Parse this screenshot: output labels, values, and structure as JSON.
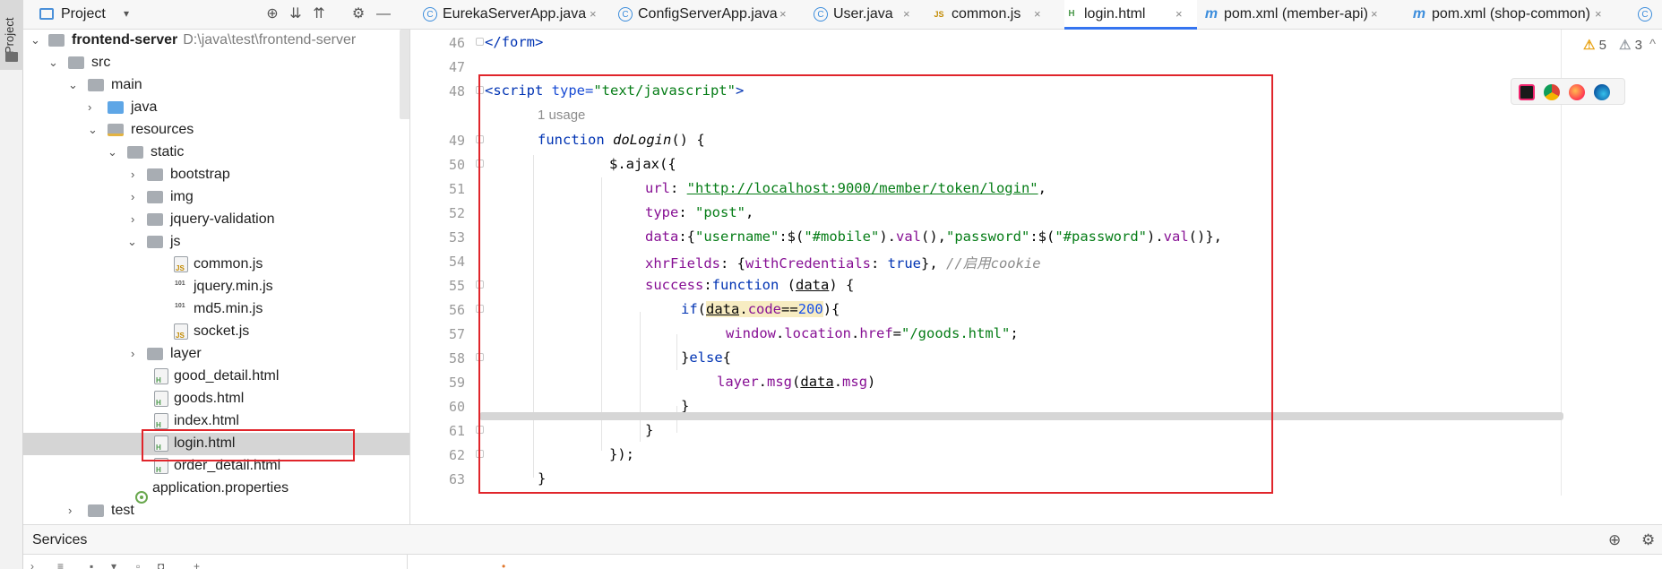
{
  "tool_stripe": {
    "label": "Project"
  },
  "project_header": {
    "title": "Project",
    "caret": "▾",
    "btn_locate": "⊕",
    "btn_expand": "⇊",
    "btn_collapse": "⇈",
    "btn_settings": "⚙",
    "btn_hide": "—"
  },
  "tabs": [
    {
      "label": "EurekaServerApp.java",
      "icon": "C"
    },
    {
      "label": "ConfigServerApp.java",
      "icon": "C"
    },
    {
      "label": "User.java",
      "icon": "C"
    },
    {
      "label": "common.js",
      "icon": "JS"
    },
    {
      "label": "login.html",
      "icon": "H"
    },
    {
      "label": "pom.xml (member-api)",
      "icon": "m"
    },
    {
      "label": "pom.xml (shop-common)",
      "icon": "m"
    },
    {
      "label": "",
      "icon": "C"
    }
  ],
  "tab_close": "×",
  "tree": {
    "root": {
      "name": "frontend-server",
      "path": "D:\\java\\test\\frontend-server"
    },
    "src": "src",
    "main": "main",
    "java": "java",
    "resources": "resources",
    "static": "static",
    "bootstrap": "bootstrap",
    "img": "img",
    "jquery_validation": "jquery-validation",
    "js": "js",
    "common_js": "common.js",
    "jquery_min_js": "jquery.min.js",
    "md5_min_js": "md5.min.js",
    "socket_js": "socket.js",
    "layer": "layer",
    "good_detail": "good_detail.html",
    "goods": "goods.html",
    "index": "index.html",
    "login": "login.html",
    "order_detail": "order_detail.html",
    "app_props": "application.properties",
    "test": "test",
    "file_badge_js": "JS",
    "file_badge_html": "H",
    "file_badge_bin": "101"
  },
  "editor": {
    "line_numbers": [
      "46",
      "47",
      "48",
      "49",
      "50",
      "51",
      "52",
      "53",
      "54",
      "55",
      "56",
      "57",
      "58",
      "59",
      "60",
      "61",
      "62",
      "63"
    ],
    "usage_hint": "1 usage",
    "warnings": {
      "count_a": "5",
      "count_b": "3",
      "tri": "⚠",
      "caret": "^"
    },
    "code": {
      "l46_tag": "</form>",
      "l48_open": "<script ",
      "l48_attr": "type=",
      "l48_val": "\"text/javascript\"",
      "l48_close": ">",
      "l49_kw": "function ",
      "l49_fn": "doLogin",
      "l49_rest": "() {",
      "l50": "$.ajax({",
      "l51_key": "url",
      "l51_sep": ": ",
      "l51_url": "\"http://localhost:9000/member/token/login\"",
      "l51_end": ",",
      "l52_key": "type",
      "l52_sep": ": ",
      "l52_val": "\"post\"",
      "l52_end": ",",
      "l53_key": "data",
      "l53_a": ":{",
      "l53_s1": "\"username\"",
      "l53_b": ":$(",
      "l53_s2": "\"#mobile\"",
      "l53_c": ").",
      "l53_val1": "val",
      "l53_d": "(),",
      "l53_s3": "\"password\"",
      "l53_e": ":$(",
      "l53_s4": "\"#password\"",
      "l53_f": ").",
      "l53_val2": "val",
      "l53_g": "()},",
      "l54_key": "xhrFields",
      "l54_a": ": {",
      "l54_key2": "withCredentials",
      "l54_b": ": ",
      "l54_true": "true",
      "l54_c": "}, ",
      "l54_cmt": "//启用cookie",
      "l55_key": "success",
      "l55_a": ":",
      "l55_kw": "function ",
      "l55_b": "(",
      "l55_param": "data",
      "l55_c": ") {",
      "l56_kw": "if",
      "l56_a": "(",
      "l56_data": "data",
      "l56_b": ".",
      "l56_code": "code",
      "l56_c": "==",
      "l56_num": "200",
      "l56_d": "){",
      "l57_a": "window",
      "l57_b": ".",
      "l57_c": "location",
      "l57_d": ".",
      "l57_e": "href",
      "l57_f": "=",
      "l57_str": "\"/goods.html\"",
      "l57_g": ";",
      "l58_a": "}",
      "l58_kw": "else",
      "l58_b": "{",
      "l59_a": "layer",
      "l59_b": ".",
      "l59_c": "msg",
      "l59_d": "(",
      "l59_data": "data",
      "l59_e": ".",
      "l59_msg": "msg",
      "l59_f": ")",
      "l60": "}",
      "l61": "}",
      "l62": "});",
      "l63": "}"
    }
  },
  "services": {
    "title": "Services",
    "btn_target": "⊕",
    "btn_settings": "⚙"
  },
  "colors": {
    "selection_box": "#e0252b",
    "active_tab": "#3574f0",
    "keyword": "#0033b3",
    "string": "#067d17",
    "property": "#871094"
  }
}
